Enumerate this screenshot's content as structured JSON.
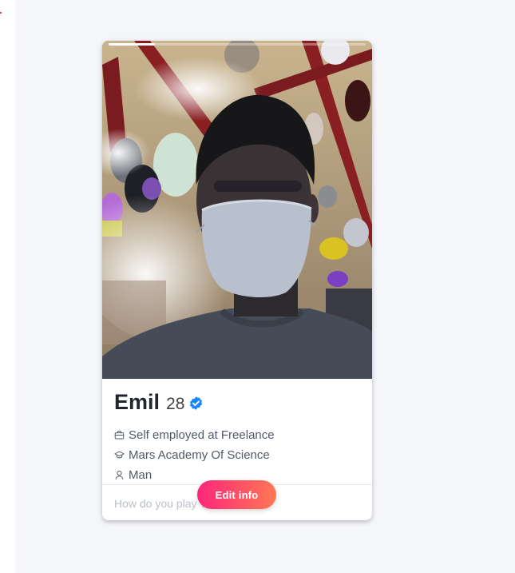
{
  "profile": {
    "name": "Emil",
    "age": "28",
    "verified": true,
    "details": [
      {
        "icon": "briefcase-icon",
        "text": "Self employed at Freelance"
      },
      {
        "icon": "graduation-cap-icon",
        "text": "Mars Academy Of Science"
      },
      {
        "icon": "person-icon",
        "text": "Man"
      }
    ],
    "bio_placeholder": "How do you play Tinder?",
    "photo_progress": 0.18
  },
  "actions": {
    "edit_label": "Edit info"
  },
  "colors": {
    "page_bg": "#f5f6fa",
    "button_gradient_start": "#fd267a",
    "button_gradient_end": "#ff7854",
    "verified_badge": "#1786ff",
    "name_text": "#21262e"
  }
}
